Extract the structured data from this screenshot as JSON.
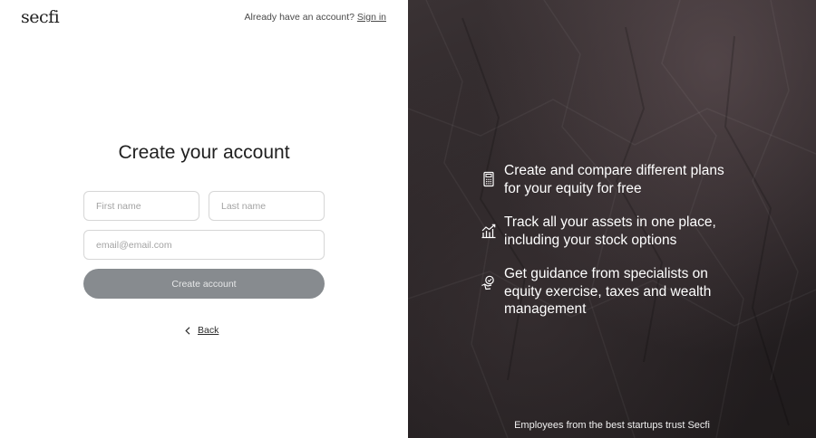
{
  "brand": {
    "logo_text": "secfi"
  },
  "header": {
    "prompt": "Already have an account?",
    "signin_link": "Sign in"
  },
  "form": {
    "title": "Create your account",
    "first_name_placeholder": "First name",
    "last_name_placeholder": "Last name",
    "email_placeholder": "email@email.com",
    "submit_label": "Create account",
    "back_label": "Back"
  },
  "features": [
    {
      "icon": "calculator-icon",
      "text": "Create and compare different plans for your equity for free"
    },
    {
      "icon": "chart-growth-icon",
      "text": "Track all your assets in one place, including your stock options"
    },
    {
      "icon": "advisor-hand-icon",
      "text": "Get guidance from specialists on equity exercise, taxes and wealth management"
    }
  ],
  "footer": {
    "trust_text": "Employees from the best startups trust Secfi"
  },
  "colors": {
    "button_bg": "#878b8f",
    "button_text": "#e6e7e8",
    "panel_bg": "#2b2527",
    "text_dark": "#1f1f1f"
  }
}
